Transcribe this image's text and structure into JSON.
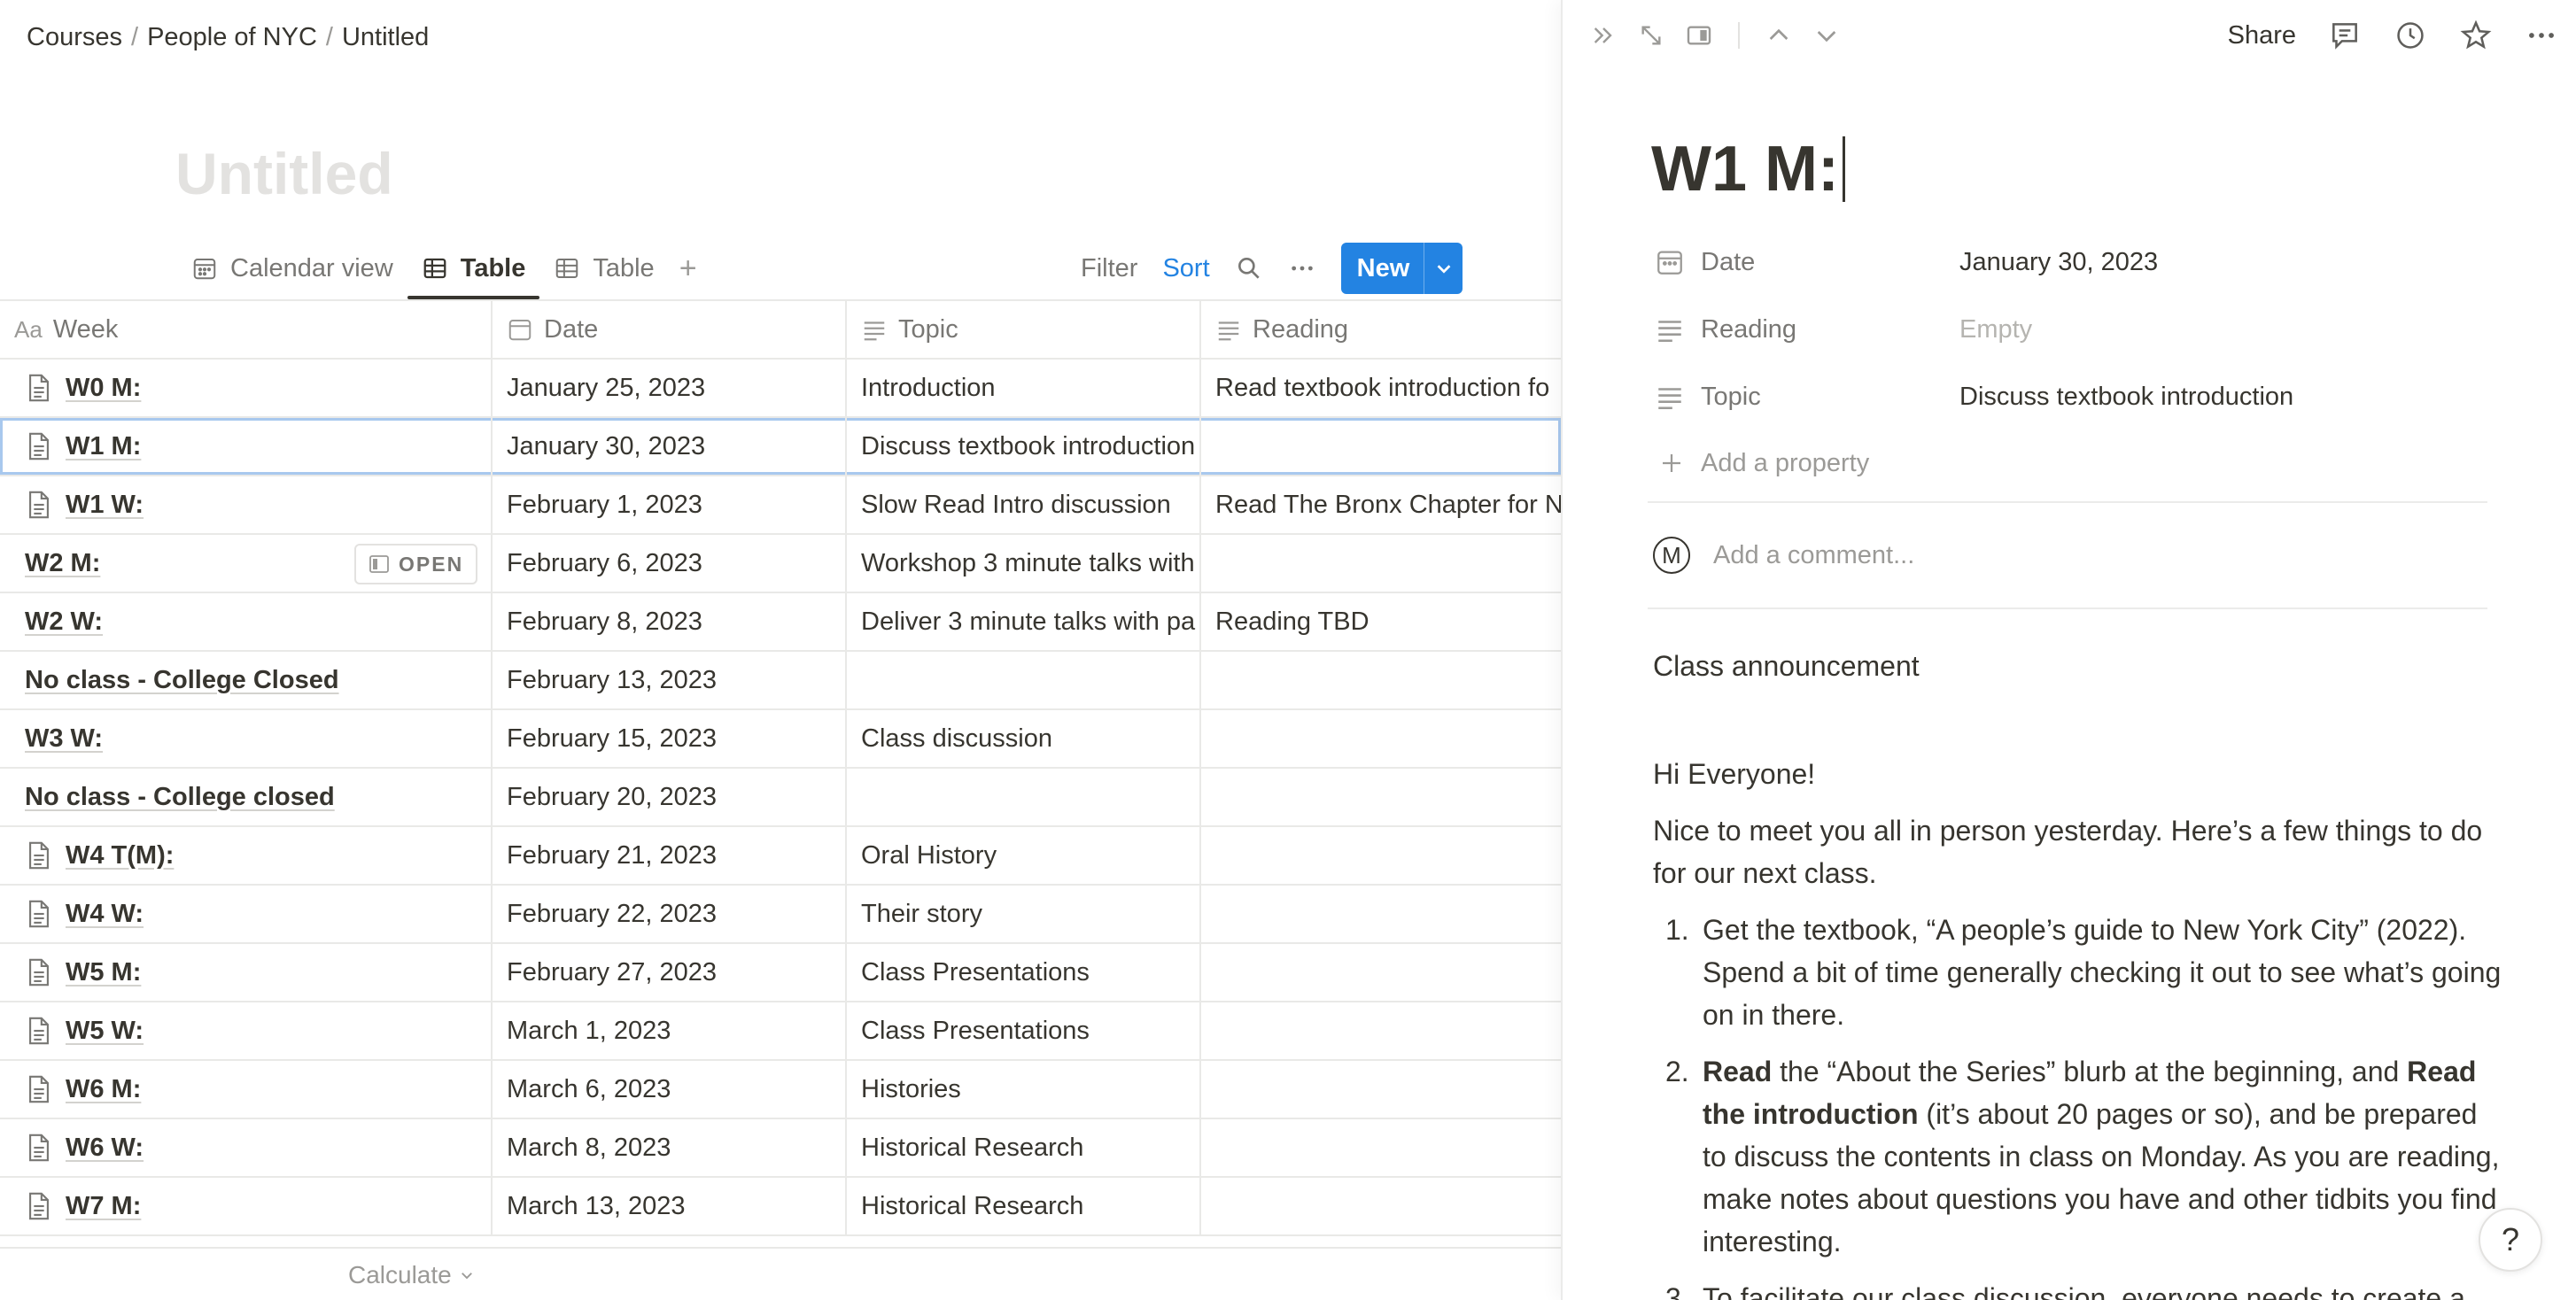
{
  "breadcrumb": [
    "Courses",
    "People of NYC",
    "Untitled"
  ],
  "page": {
    "title": "Untitled"
  },
  "views": [
    {
      "label": "Calendar view",
      "icon": "calendar-icon",
      "active": false
    },
    {
      "label": "Table",
      "icon": "table-icon",
      "active": true
    },
    {
      "label": "Table",
      "icon": "table-icon",
      "active": false
    }
  ],
  "toolbar": {
    "filter": "Filter",
    "sort": "Sort",
    "new": "New"
  },
  "table": {
    "headers": [
      "Week",
      "Date",
      "Topic",
      "Reading"
    ],
    "header_prefix": "Aa",
    "open_label": "OPEN",
    "rows": [
      {
        "week": "W0 M:",
        "date": "January 25, 2023",
        "topic": "Introduction",
        "reading": "Read textbook introduction fo",
        "page_icon": true
      },
      {
        "week": "W1 M:",
        "date": "January 30, 2023",
        "topic": "Discuss textbook introduction",
        "reading": "",
        "page_icon": true,
        "selected": true
      },
      {
        "week": "W1 W:",
        "date": "February 1, 2023",
        "topic": "Slow Read Intro discussion",
        "reading": "Read The Bronx Chapter for N",
        "page_icon": true
      },
      {
        "week": "W2 M:",
        "date": "February 6, 2023",
        "topic": "Workshop 3 minute talks with",
        "reading": "",
        "page_icon": false,
        "hover": true
      },
      {
        "week": "W2 W:",
        "date": "February 8, 2023",
        "topic": "Deliver 3 minute talks with pa",
        "reading": "Reading TBD",
        "page_icon": false
      },
      {
        "week": "No class - College Closed",
        "date": "February 13, 2023",
        "topic": "",
        "reading": "",
        "page_icon": false
      },
      {
        "week": "W3 W:",
        "date": "February 15, 2023",
        "topic": "Class discussion",
        "reading": "",
        "page_icon": false
      },
      {
        "week": "No class - College closed",
        "date": "February 20, 2023",
        "topic": "",
        "reading": "",
        "page_icon": false
      },
      {
        "week": "W4 T(M):",
        "date": "February 21, 2023",
        "topic": "Oral History",
        "reading": "",
        "page_icon": true
      },
      {
        "week": "W4 W:",
        "date": "February 22, 2023",
        "topic": "Their story",
        "reading": "",
        "page_icon": true
      },
      {
        "week": "W5 M:",
        "date": "February 27, 2023",
        "topic": "Class Presentations",
        "reading": "",
        "page_icon": true
      },
      {
        "week": "W5 W:",
        "date": "March 1, 2023",
        "topic": "Class Presentations",
        "reading": "",
        "page_icon": true
      },
      {
        "week": "W6 M:",
        "date": "March 6, 2023",
        "topic": "Histories",
        "reading": "",
        "page_icon": true
      },
      {
        "week": "W6 W:",
        "date": "March 8, 2023",
        "topic": "Historical Research",
        "reading": "",
        "page_icon": true
      },
      {
        "week": "W7 M:",
        "date": "March 13, 2023",
        "topic": "Historical Research",
        "reading": "",
        "page_icon": true
      }
    ],
    "calculate": "Calculate"
  },
  "peek": {
    "share": "Share",
    "title": "W1 M:",
    "properties": [
      {
        "name": "Date",
        "value": "January 30, 2023",
        "icon": "calendar-icon",
        "empty": false
      },
      {
        "name": "Reading",
        "value": "Empty",
        "icon": "text-lines-icon",
        "empty": true
      },
      {
        "name": "Topic",
        "value": "Discuss textbook introduction",
        "icon": "text-lines-icon",
        "empty": false
      }
    ],
    "add_property": "Add a property",
    "avatar_letter": "M",
    "comment_placeholder": "Add a comment...",
    "content": {
      "heading": "Class announcement",
      "greeting": "Hi Everyone!",
      "intro": "Nice to meet you all in person yesterday. Here’s a few things to do for our next class.",
      "items": [
        {
          "num": "1.",
          "text": "Get the textbook, “A people’s guide to New York City” (2022). Spend a bit of time generally checking it out to see what’s going on in there."
        },
        {
          "num": "2.",
          "bold1": "Read",
          "text1": " the “About the Series” blurb at the beginning, and ",
          "bold2": "Read the introduction",
          "text2": " (it’s about 20 pages or so), and be prepared to discuss the contents in class on Monday. As you are reading, make notes about questions you have and other tidbits you find interesting."
        },
        {
          "num": "3.",
          "text": "To facilitate our class discussion, everyone needs to create a"
        }
      ]
    },
    "help": "?"
  }
}
